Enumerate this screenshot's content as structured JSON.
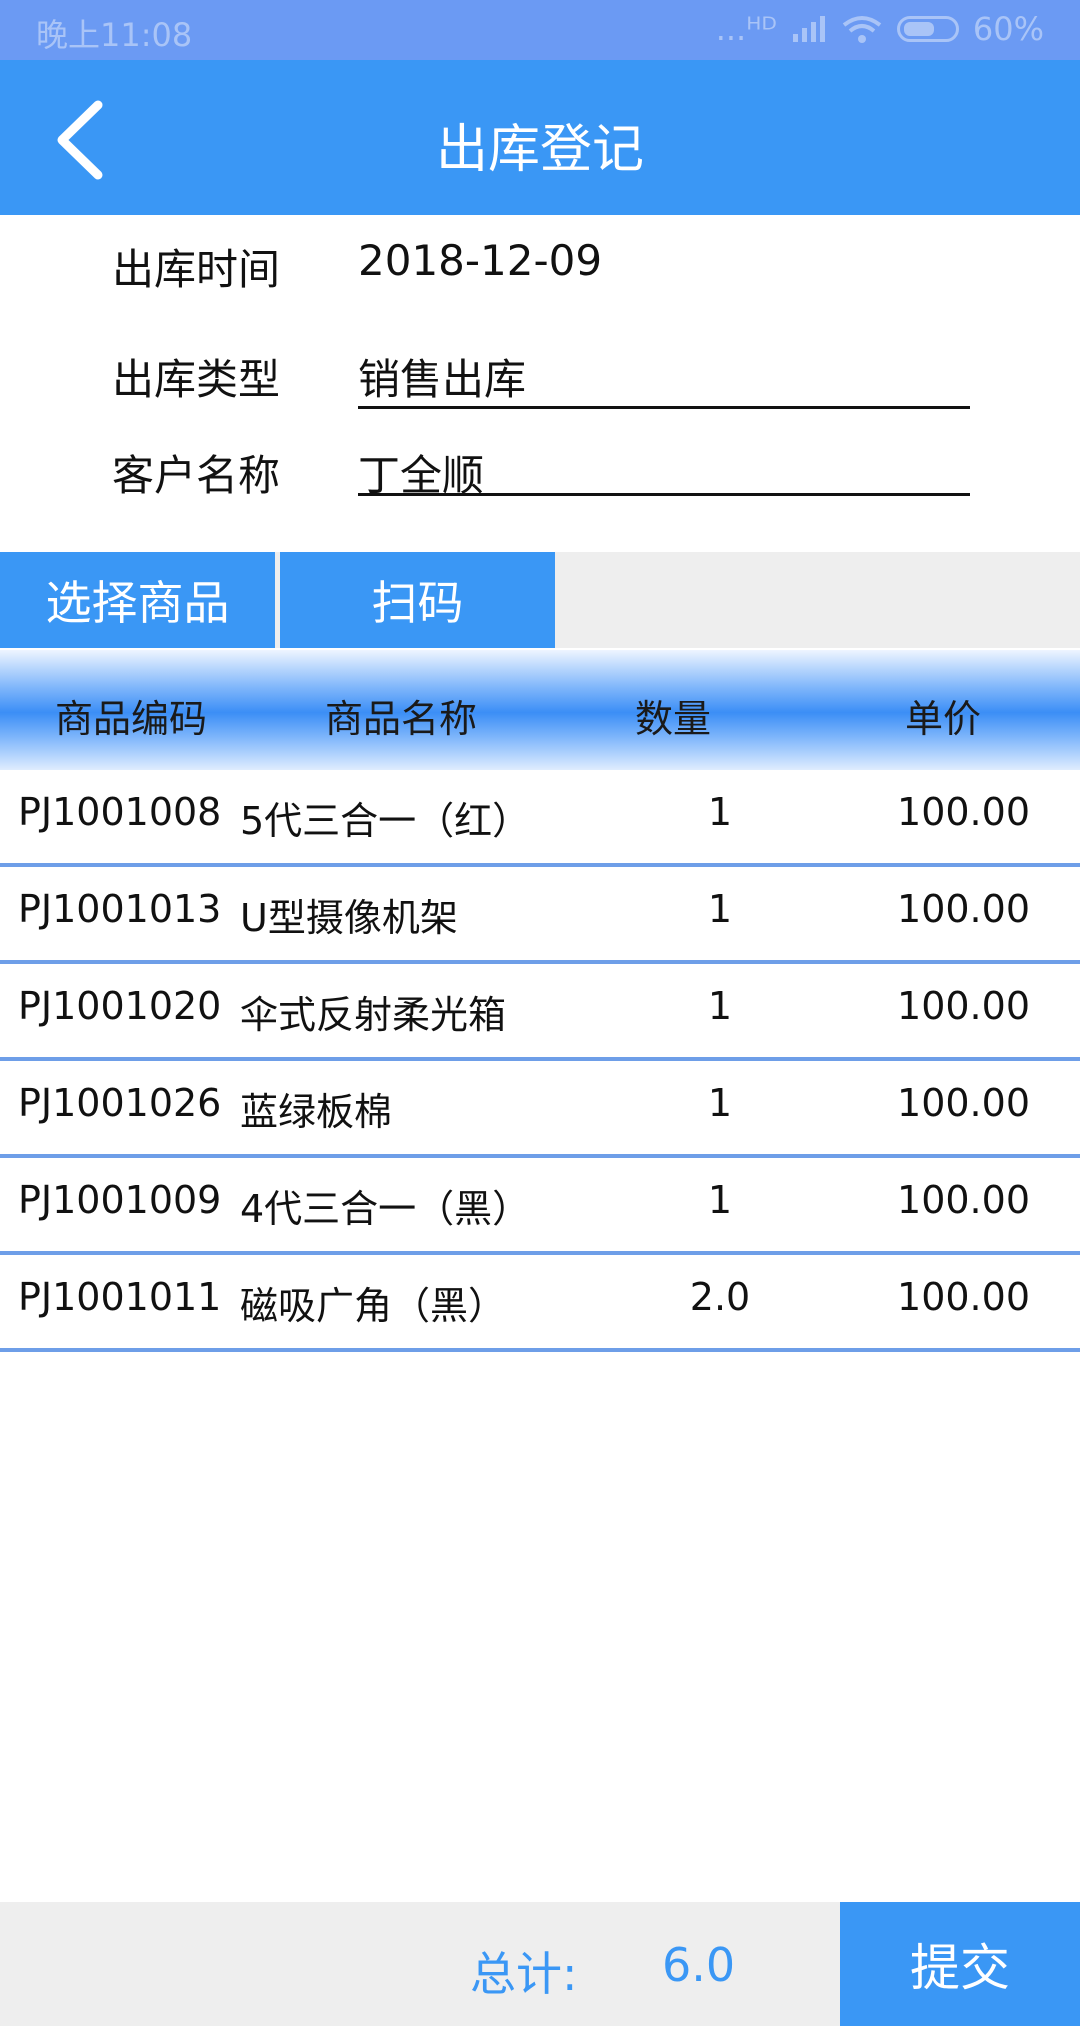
{
  "status_bar": {
    "time": "晚上11:08",
    "signal": "...ᴴᴰ",
    "battery": "60%"
  },
  "header": {
    "title": "出库登记",
    "back_icon": "chevron-left-icon"
  },
  "form": {
    "date_label": "出库时间",
    "date_value": "2018-12-09",
    "type_label": "出库类型",
    "type_value": "销售出库",
    "customer_label": "客户名称",
    "customer_value": "丁全顺"
  },
  "actions": {
    "select_goods": "选择商品",
    "scan": "扫码"
  },
  "table": {
    "columns": [
      "商品编码",
      "商品名称",
      "数量",
      "单价"
    ],
    "rows": [
      {
        "code": "PJ1001008",
        "name": "5代三合一（红）",
        "qty": "1",
        "price": "100.00"
      },
      {
        "code": "PJ1001013",
        "name": "U型摄像机架",
        "qty": "1",
        "price": "100.00"
      },
      {
        "code": "PJ1001020",
        "name": "伞式反射柔光箱",
        "qty": "1",
        "price": "100.00"
      },
      {
        "code": "PJ1001026",
        "name": "蓝绿板棉",
        "qty": "1",
        "price": "100.00"
      },
      {
        "code": "PJ1001009",
        "name": "4代三合一（黑）",
        "qty": "1",
        "price": "100.00"
      },
      {
        "code": "PJ1001011",
        "name": "磁吸广角（黑）",
        "qty": "2.0",
        "price": "100.00"
      }
    ]
  },
  "footer": {
    "total_label": "总计:",
    "total_value": "6.0",
    "submit": "提交"
  },
  "colors": {
    "primary": "#3a97f5",
    "status_bar": "#6b9af3",
    "divider": "#6e9ee8"
  }
}
